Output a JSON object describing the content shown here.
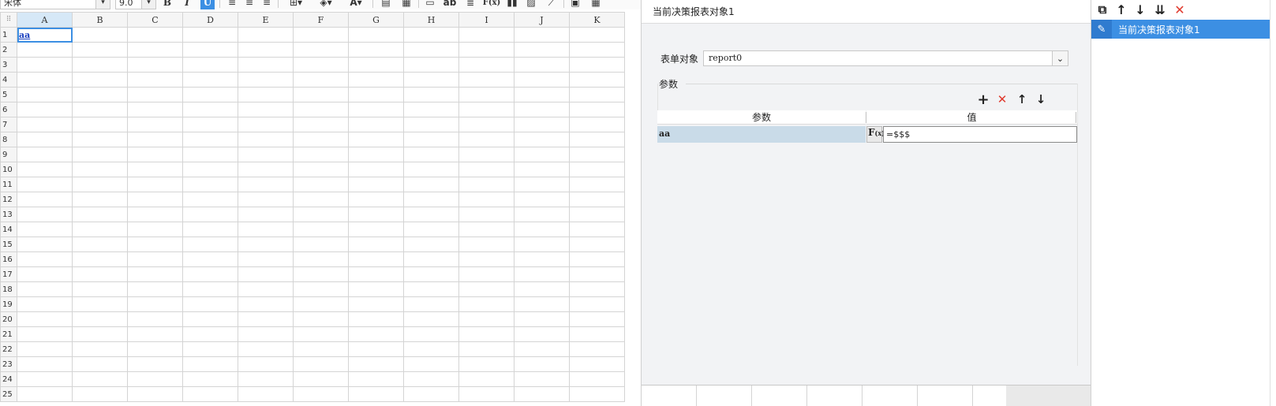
{
  "toolbar": {
    "font_family": "宋体",
    "font_size": "9.0",
    "bold": "B",
    "italic": "I",
    "underline": "U",
    "dropdown_glyph": "▾",
    "formula_label": "F(x)",
    "text_label": "ab",
    "font_color_label": "A"
  },
  "sheet": {
    "columns": [
      "A",
      "B",
      "C",
      "D",
      "E",
      "F",
      "G",
      "H",
      "I",
      "J",
      "K"
    ],
    "rows": [
      "1",
      "2",
      "3",
      "4",
      "5",
      "6",
      "7",
      "8",
      "9",
      "10",
      "11",
      "12",
      "13",
      "14",
      "15",
      "16",
      "17",
      "18",
      "19",
      "20",
      "21",
      "22",
      "23",
      "24",
      "25"
    ],
    "selected_cell": "A1",
    "cell_a1_value": "aa",
    "corner_glyph": "⠿"
  },
  "panel": {
    "title": "当前决策报表对象1",
    "form_label": "表单对象",
    "form_value": "report0",
    "params_group_label": "参数",
    "param_header_name": "参数",
    "param_header_value": "值",
    "params": [
      {
        "name": "aa",
        "value": "=$$$"
      }
    ],
    "fx_label": "F",
    "fx_sub": "(x)",
    "add_glyph": "+",
    "delete_glyph": "✕",
    "up_glyph": "↑",
    "down_glyph": "↓",
    "select_arrow": "⌄"
  },
  "right_panel": {
    "items": [
      {
        "label": "当前决策报表对象1",
        "selected": true
      }
    ],
    "pen_glyph": "✎",
    "copy_glyph": "⧉",
    "up_glyph": "↑",
    "down_glyph": "↓",
    "move_bottom_glyph": "⇊",
    "delete_glyph": "✕"
  },
  "colors": {
    "accent": "#3c8fe3",
    "delete_red": "#e03a2e",
    "param_row_bg": "#c9dbe8"
  }
}
